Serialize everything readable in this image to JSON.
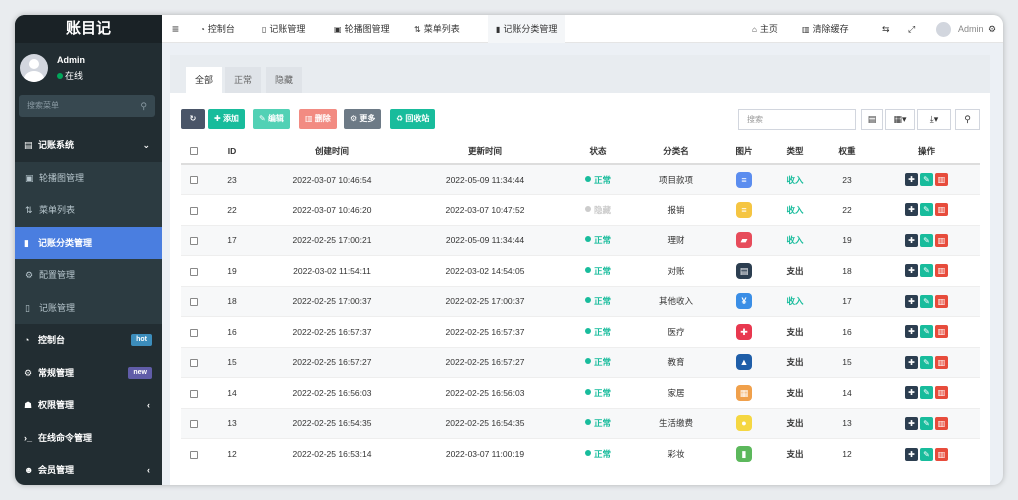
{
  "app": {
    "title": "账目记"
  },
  "user": {
    "name": "Admin",
    "status": "在线"
  },
  "sidebar": {
    "search_placeholder": "搜索菜单",
    "items": [
      {
        "label": "记账系统",
        "icon": "book-icon",
        "type": "top",
        "arrow": "⌄"
      },
      {
        "label": "轮播图管理",
        "icon": "image-icon",
        "type": "sub"
      },
      {
        "label": "菜单列表",
        "icon": "sort-icon",
        "type": "sub"
      },
      {
        "label": "记账分类管理",
        "icon": "file-icon",
        "type": "active"
      },
      {
        "label": "配置管理",
        "icon": "gear-icon",
        "type": "sub"
      },
      {
        "label": "记账管理",
        "icon": "document-icon",
        "type": "sub"
      },
      {
        "label": "控制台",
        "icon": "dashboard-icon",
        "type": "top",
        "badge": "hot",
        "badge_color": "#3c8dbc"
      },
      {
        "label": "常规管理",
        "icon": "cogs-icon",
        "type": "top",
        "badge": "new",
        "badge_color": "#605ca8"
      },
      {
        "label": "权限管理",
        "icon": "group-icon",
        "type": "top",
        "arrow": "‹"
      },
      {
        "label": "在线命令管理",
        "icon": "terminal-icon",
        "type": "top"
      },
      {
        "label": "会员管理",
        "icon": "member-icon",
        "type": "top",
        "arrow": "‹"
      }
    ]
  },
  "topbar": {
    "tabs": [
      "控制台",
      "记账管理",
      "轮播图管理",
      "菜单列表",
      "记账分类管理"
    ],
    "home": "主页",
    "clear_cache": "清除缓存",
    "admin": "Admin"
  },
  "filter_tabs": [
    "全部",
    "正常",
    "隐藏"
  ],
  "toolbar": {
    "add": "添加",
    "edit": "编辑",
    "delete": "删除",
    "more": "更多",
    "recycle": "回收站",
    "search_placeholder": "搜索"
  },
  "table": {
    "headers": [
      "ID",
      "创建时间",
      "更新时间",
      "状态",
      "分类名",
      "图片",
      "类型",
      "权重",
      "操作"
    ],
    "rows": [
      {
        "id": "23",
        "created": "2022-03-07 10:46:54",
        "updated": "2022-05-09 11:34:44",
        "status": "正常",
        "status_on": true,
        "name": "项目款项",
        "icon": "≡",
        "icon_color": "#5b8def",
        "type": "收入",
        "income": true,
        "weight": "23"
      },
      {
        "id": "22",
        "created": "2022-03-07 10:46:20",
        "updated": "2022-03-07 10:47:52",
        "status": "隐藏",
        "status_on": false,
        "name": "报销",
        "icon": "≡",
        "icon_color": "#f5c542",
        "type": "收入",
        "income": true,
        "weight": "22"
      },
      {
        "id": "17",
        "created": "2022-02-25 17:00:21",
        "updated": "2022-05-09 11:34:44",
        "status": "正常",
        "status_on": true,
        "name": "理财",
        "icon": "▰",
        "icon_color": "#e74c5b",
        "type": "收入",
        "income": true,
        "weight": "19"
      },
      {
        "id": "19",
        "created": "2022-03-02 11:54:11",
        "updated": "2022-03-02 14:54:05",
        "status": "正常",
        "status_on": true,
        "name": "对账",
        "icon": "▤",
        "icon_color": "#2c3e50",
        "type": "支出",
        "income": false,
        "weight": "18"
      },
      {
        "id": "18",
        "created": "2022-02-25 17:00:37",
        "updated": "2022-02-25 17:00:37",
        "status": "正常",
        "status_on": true,
        "name": "其他收入",
        "icon": "¥",
        "icon_color": "#3a8ee6",
        "type": "收入",
        "income": true,
        "weight": "17"
      },
      {
        "id": "16",
        "created": "2022-02-25 16:57:37",
        "updated": "2022-02-25 16:57:37",
        "status": "正常",
        "status_on": true,
        "name": "医疗",
        "icon": "✚",
        "icon_color": "#e8384f",
        "type": "支出",
        "income": false,
        "weight": "16"
      },
      {
        "id": "15",
        "created": "2022-02-25 16:57:27",
        "updated": "2022-02-25 16:57:27",
        "status": "正常",
        "status_on": true,
        "name": "教育",
        "icon": "▲",
        "icon_color": "#1f5ea8",
        "type": "支出",
        "income": false,
        "weight": "15"
      },
      {
        "id": "14",
        "created": "2022-02-25 16:56:03",
        "updated": "2022-02-25 16:56:03",
        "status": "正常",
        "status_on": true,
        "name": "家居",
        "icon": "▦",
        "icon_color": "#f0a04b",
        "type": "支出",
        "income": false,
        "weight": "14"
      },
      {
        "id": "13",
        "created": "2022-02-25 16:54:35",
        "updated": "2022-02-25 16:54:35",
        "status": "正常",
        "status_on": true,
        "name": "生活缴费",
        "icon": "●",
        "icon_color": "#f5d742",
        "type": "支出",
        "income": false,
        "weight": "13"
      },
      {
        "id": "12",
        "created": "2022-02-25 16:53:14",
        "updated": "2022-03-07 11:00:19",
        "status": "正常",
        "status_on": true,
        "name": "彩妆",
        "icon": "▮",
        "icon_color": "#5cb85c",
        "type": "支出",
        "income": false,
        "weight": "12"
      }
    ]
  },
  "colors": {
    "green": "#18bc9c",
    "dark": "#222d32",
    "active": "#4a7ee0",
    "add": "#18bc9c",
    "edit": "#52d1b5",
    "delete": "#f28b82",
    "more": "#6d7a86",
    "recycle": "#18bc9c"
  }
}
